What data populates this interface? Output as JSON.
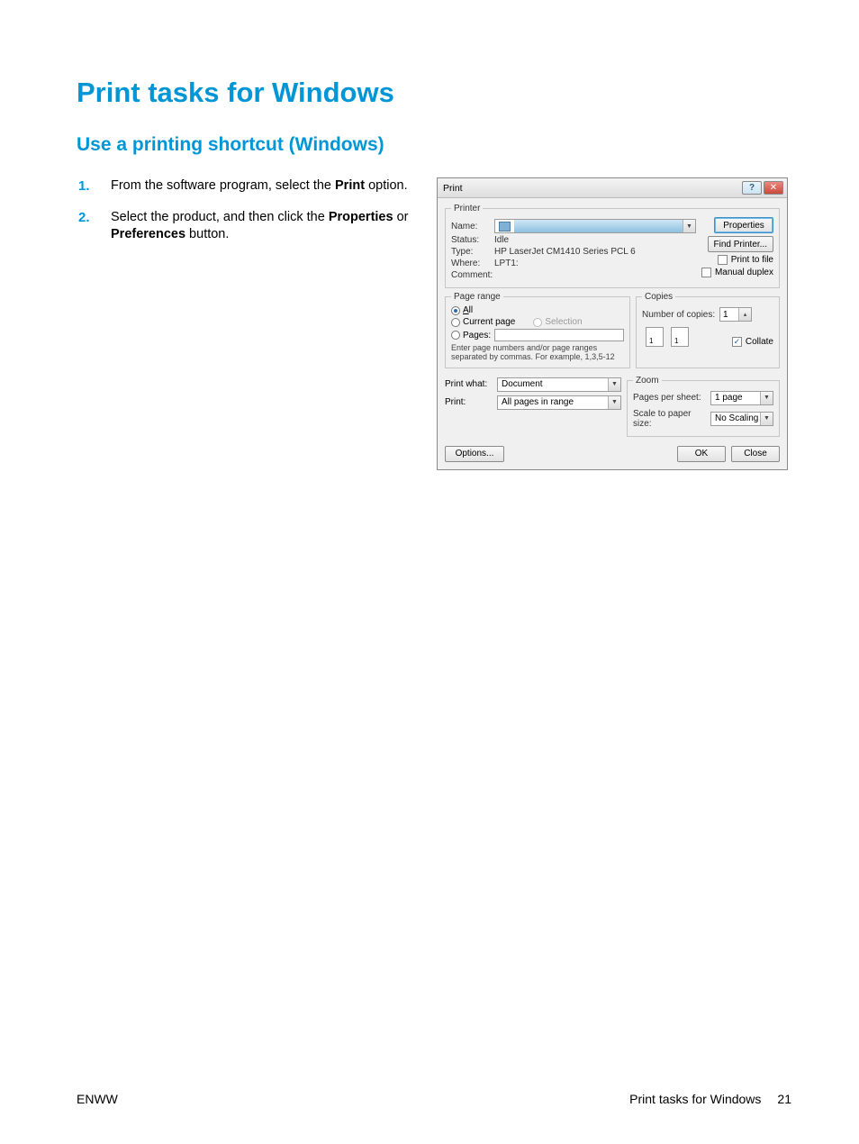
{
  "heading": "Print tasks for Windows",
  "subheading": "Use a printing shortcut (Windows)",
  "steps": {
    "s1_a": "From the software program, select the ",
    "s1_b": "Print",
    "s1_c": " option.",
    "s2_a": "Select the product, and then click the ",
    "s2_b": "Properties",
    "s2_c": " or ",
    "s2_d": "Preferences",
    "s2_e": " button."
  },
  "dialog": {
    "title": "Print",
    "help_glyph": "?",
    "close_glyph": "✕",
    "printer": {
      "legend": "Printer",
      "name_label": "Name:",
      "status_label": "Status:",
      "status_value": "Idle",
      "type_label": "Type:",
      "type_value": "HP LaserJet CM1410 Series PCL 6",
      "where_label": "Where:",
      "where_value": "LPT1:",
      "comment_label": "Comment:",
      "properties_btn": "Properties",
      "find_btn": "Find Printer...",
      "print_to_file": "Print to file",
      "manual_duplex": "Manual duplex"
    },
    "page_range": {
      "legend": "Page range",
      "all": "All",
      "current": "Current page",
      "selection": "Selection",
      "pages": "Pages:",
      "hint": "Enter page numbers and/or page ranges separated by commas.  For example, 1,3,5-12"
    },
    "copies": {
      "legend": "Copies",
      "num_label": "Number of copies:",
      "num_value": "1",
      "collate": "Collate",
      "one": "1"
    },
    "print_what_label": "Print what:",
    "print_what_value": "Document",
    "print_label": "Print:",
    "print_value": "All pages in range",
    "zoom": {
      "legend": "Zoom",
      "pps_label": "Pages per sheet:",
      "pps_value": "1 page",
      "scale_label": "Scale to paper size:",
      "scale_value": "No Scaling"
    },
    "options_btn": "Options...",
    "ok_btn": "OK",
    "close_btn": "Close"
  },
  "footer": {
    "left": "ENWW",
    "right": "Print tasks for Windows",
    "page": "21"
  }
}
